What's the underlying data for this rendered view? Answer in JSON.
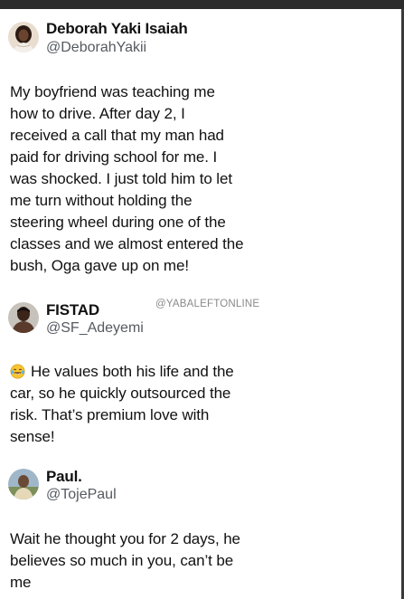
{
  "posts": [
    {
      "author_name": "Deborah Yaki Isaiah",
      "author_handle": "@DeborahYakii",
      "avatar_icon": "profile-photo-woman",
      "text_lines": [
        "My boyfriend was teaching me",
        "how to drive. After day 2, I",
        "received a call that my man had",
        "paid for driving school for me. I",
        "was shocked. I just told him to let",
        "me turn without holding the",
        "steering wheel during one of the",
        "classes and we almost entered the",
        "bush, Oga gave up on me!"
      ]
    },
    {
      "author_name": "FISTAD",
      "author_handle": "@SF_Adeyemi",
      "avatar_icon": "profile-photo-man",
      "leading_icon": "laughing-tears-emoji",
      "text_lines": [
        "He values both his life and the",
        "car, so he quickly outsourced the",
        "risk. That’s premium love with",
        "sense!"
      ]
    },
    {
      "author_name": "Paul.",
      "author_handle": "@TojePaul",
      "avatar_icon": "profile-photo-outdoor",
      "text_lines": [
        "Wait he thought you for 2 days, he",
        "believes so much in you, can’t be",
        "me"
      ]
    }
  ],
  "watermark": "@YABALEFTONLINE",
  "colors": {
    "text": "#111111",
    "handle": "#555a60",
    "watermark": "#8a8a8a",
    "top_bar": "#2b2b2b"
  }
}
